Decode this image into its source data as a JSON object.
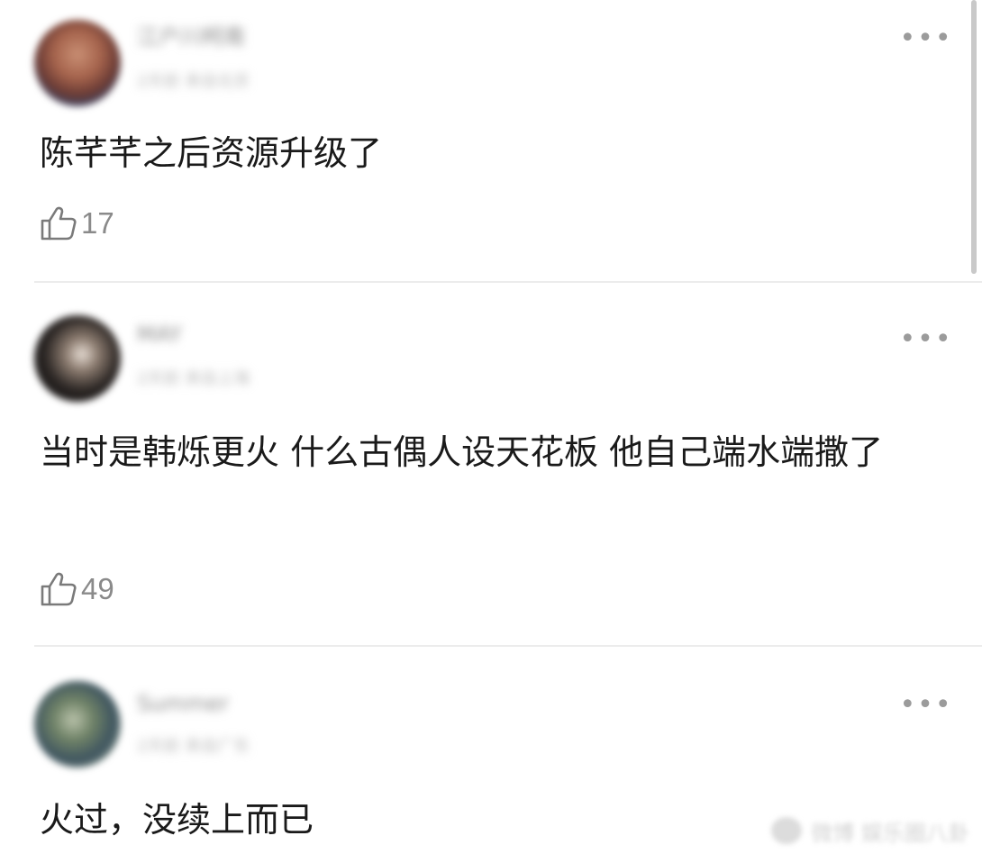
{
  "comments": [
    {
      "user": "江户川柯南",
      "meta": "2天前 来自北京",
      "text": "陈芊芊之后资源升级了",
      "likes": "17"
    },
    {
      "user": "MAY",
      "meta": "2天前 来自上海",
      "text": "当时是韩烁更火 什么古偶人设天花板 他自己端水端撒了",
      "likes": "49"
    },
    {
      "user": "Summer",
      "meta": "2天前 来自广东",
      "text": "火过，没续上而已",
      "likes": ""
    }
  ],
  "more_label": "•••",
  "watermark": "微博 娱乐圈八卦",
  "icons": {
    "like": "thumbs-up-icon",
    "more": "more-horizontal-icon"
  },
  "colors": {
    "text": "#1a1a1a",
    "muted": "#8a8a8a",
    "divider": "#ececec"
  }
}
